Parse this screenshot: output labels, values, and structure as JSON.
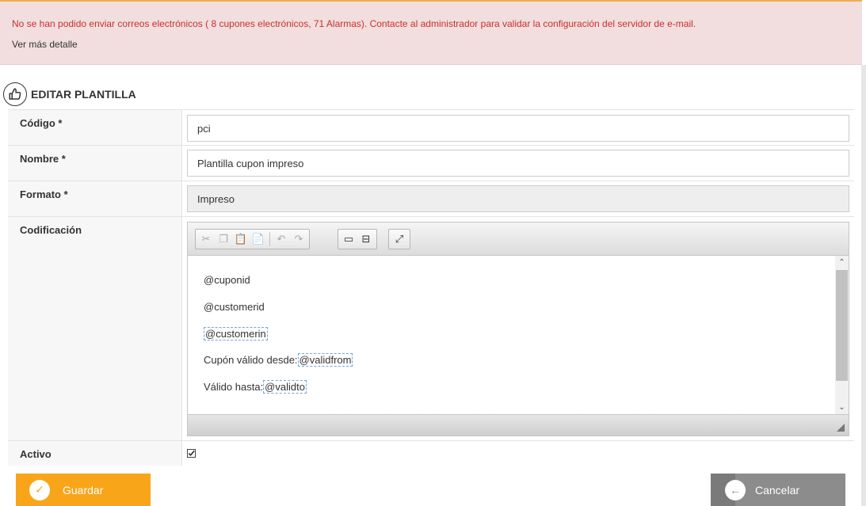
{
  "alert": {
    "message": "No se han podido enviar correos electrónicos ( 8 cupones electrónicos, 71 Alarmas). Contacte al administrador para validar la configuración del servidor de e-mail.",
    "detail_link": "Ver más detalle"
  },
  "page": {
    "title": "EDITAR PLANTILLA",
    "title_icon": "thumbs-up-icon"
  },
  "form": {
    "codigo": {
      "label": "Código *",
      "value": "pci"
    },
    "nombre": {
      "label": "Nombre *",
      "value": "Plantilla cupon impreso"
    },
    "formato": {
      "label": "Formato *",
      "value": "Impreso"
    },
    "codificacion": {
      "label": "Codificación",
      "lines": [
        {
          "text": "@cuponid",
          "placeholder": ""
        },
        {
          "text": "@customerid",
          "placeholder": ""
        },
        {
          "text": "",
          "placeholder": "@customerin"
        },
        {
          "text": "Cupón válido desde:",
          "placeholder": "@validfrom"
        },
        {
          "text": "Válido hasta:",
          "placeholder": "@validto"
        }
      ]
    },
    "activo": {
      "label": "Activo",
      "checked": true
    }
  },
  "toolbar": {
    "buttons": [
      "cut-icon",
      "copy-icon",
      "paste-icon",
      "paste-text-icon",
      "undo-icon",
      "redo-icon",
      "insert-field-icon",
      "insert-block-icon",
      "maximize-icon"
    ]
  },
  "actions": {
    "save_label": "Guardar",
    "cancel_label": "Cancelar"
  },
  "colors": {
    "alert_bg": "#f2dede",
    "alert_text": "#c9302c",
    "save": "#f9a51a",
    "cancel": "#8c8c8c"
  }
}
